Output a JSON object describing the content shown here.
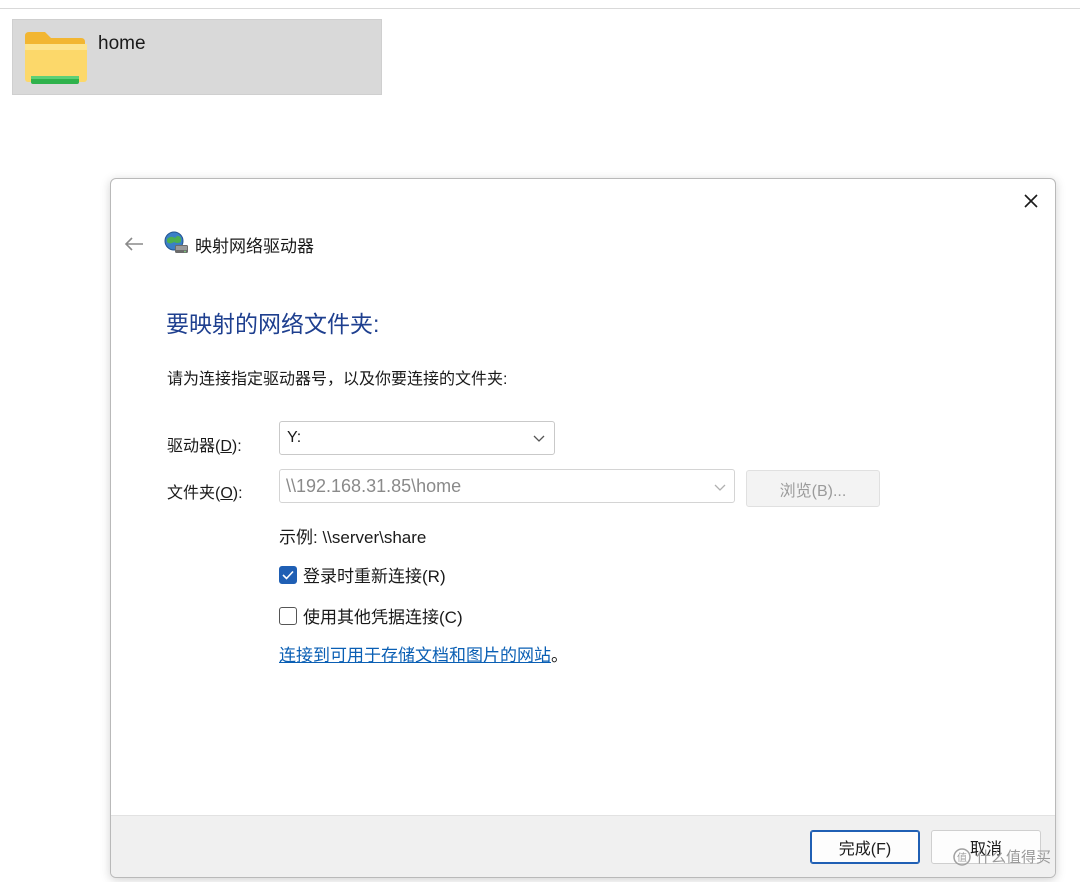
{
  "explorer": {
    "folder_name": "home"
  },
  "dialog": {
    "title": "映射网络驱动器",
    "heading": "要映射的网络文件夹:",
    "instruction": "请为连接指定驱动器号，以及你要连接的文件夹:",
    "drive_label_prefix": "驱动器(",
    "drive_label_key": "D",
    "drive_label_suffix": "):",
    "drive_value": "Y:",
    "folder_label_prefix": "文件夹(",
    "folder_label_key": "O",
    "folder_label_suffix": "):",
    "folder_value": "\\\\192.168.31.85\\home",
    "browse_label": "浏览(B)...",
    "example": "示例: \\\\server\\share",
    "reconnect_label": "登录时重新连接(R)",
    "reconnect_checked": true,
    "other_creds_label": "使用其他凭据连接(C)",
    "other_creds_checked": false,
    "link_text": "连接到可用于存储文档和图片的网站",
    "link_suffix": "。",
    "finish_label": "完成(F)",
    "cancel_label": "取消"
  },
  "watermark": {
    "text": "什么值得买"
  },
  "colors": {
    "heading": "#1e3f8f",
    "accent": "#1f5fb4",
    "link": "#0a5fb4"
  }
}
